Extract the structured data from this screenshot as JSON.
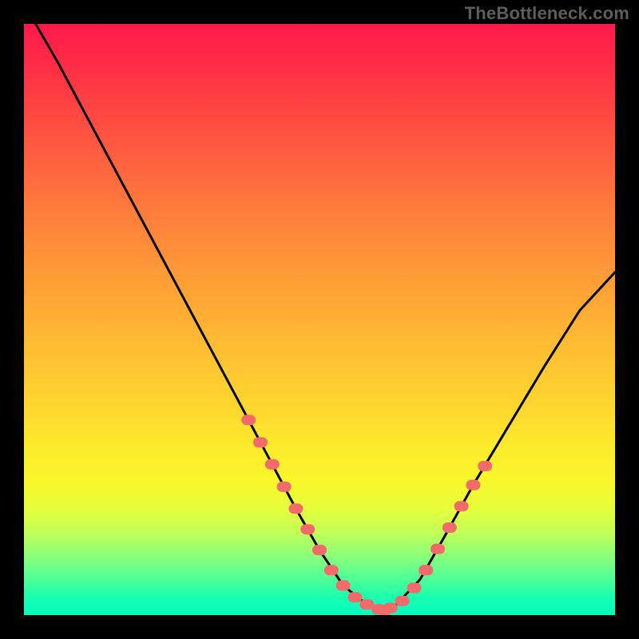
{
  "watermark": "TheBottleneck.com",
  "chart_data": {
    "type": "line",
    "title": "",
    "xlabel": "",
    "ylabel": "",
    "xlim": [
      0,
      100
    ],
    "ylim": [
      0,
      100
    ],
    "series": [
      {
        "name": "main-curve",
        "x": [
          2,
          6,
          10,
          14,
          18,
          22,
          26,
          30,
          34,
          38,
          42,
          46,
          50,
          54,
          58,
          61,
          63,
          67,
          71,
          76,
          82,
          88,
          94,
          100
        ],
        "values": [
          100,
          93,
          85.5,
          78,
          70.5,
          63,
          55.5,
          48,
          40.5,
          33,
          25.5,
          18,
          11,
          5,
          1.8,
          0.8,
          1.8,
          6,
          13,
          22,
          32,
          42,
          51.5,
          58
        ]
      },
      {
        "name": "highlight-left",
        "x": [
          38,
          40,
          42,
          44,
          46,
          48,
          50
        ],
        "values": [
          33,
          29.2,
          25.5,
          21.7,
          18,
          14.5,
          11
        ]
      },
      {
        "name": "highlight-bottom",
        "x": [
          50,
          52,
          54,
          56,
          58,
          60,
          61,
          62,
          64,
          66,
          68
        ],
        "values": [
          11,
          7.6,
          5,
          3,
          1.8,
          1,
          0.8,
          1.2,
          2.4,
          4.6,
          7.6
        ]
      },
      {
        "name": "highlight-right",
        "x": [
          68,
          70,
          72,
          74,
          76,
          78
        ],
        "values": [
          7.6,
          11.2,
          14.8,
          18.4,
          22,
          25.2
        ]
      }
    ],
    "colors": {
      "curve": "#000000",
      "highlight": "#f26a6a",
      "gradient_top": "#ff1a4a",
      "gradient_bottom": "#00ffc0"
    }
  }
}
